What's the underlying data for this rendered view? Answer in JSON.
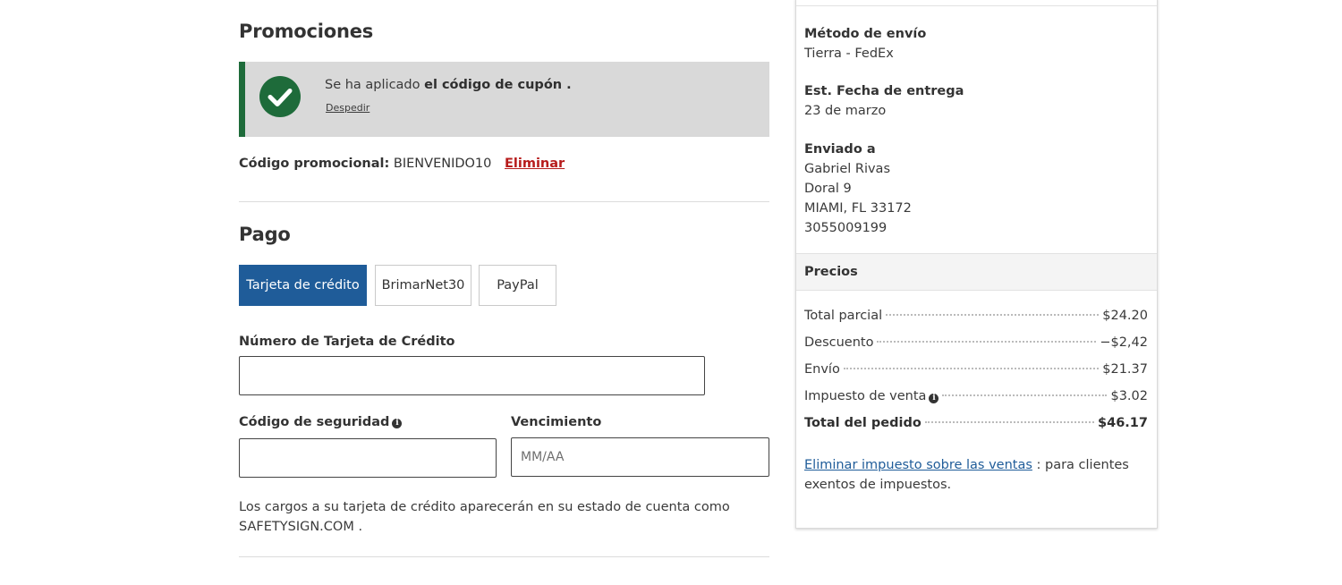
{
  "promotions": {
    "title": "Promociones",
    "banner": {
      "message_prefix": "Se ha aplicado",
      "message_bold": "el código de cupón .",
      "dismiss_label": "Despedir"
    },
    "code_label": "Código promocional:",
    "code_value": "BIENVENIDO10",
    "remove_label": "Eliminar"
  },
  "payment": {
    "title": "Pago",
    "tabs": [
      {
        "label": "Tarjeta de crédito",
        "active": true
      },
      {
        "label": "BrimarNet30",
        "active": false
      },
      {
        "label": "PayPal",
        "active": false
      }
    ],
    "card_number_label": "Número de Tarjeta de Crédito",
    "card_number_value": "",
    "security_code_label": "Código de seguridad",
    "security_code_value": "",
    "expiration_label": "Vencimiento",
    "expiration_placeholder": "MM/AA",
    "disclaimer": "Los cargos a su tarjeta de crédito aparecerán en su estado de cuenta como SAFETYSIGN.COM ."
  },
  "summary": {
    "shipping_method_label": "Método de envío",
    "shipping_method_value": "Tierra - FedEx",
    "delivery_date_label": "Est. Fecha de entrega",
    "delivery_date_value": "23 de marzo",
    "shipped_to_label": "Enviado a",
    "address": {
      "name": "Gabriel Rivas",
      "street": "Doral 9",
      "city_state_zip": "MIAMI, FL 33172",
      "phone": "3055009199"
    },
    "prices_header": "Precios",
    "prices": [
      {
        "label": "Total parcial",
        "value": "$24.20"
      },
      {
        "label": "Descuento",
        "value": "−$2,42"
      },
      {
        "label": "Envío",
        "value": "$21.37"
      },
      {
        "label": "Impuesto de venta",
        "value": "$3.02"
      },
      {
        "label": "Total del pedido",
        "value": "$46.17"
      }
    ],
    "tax_exempt_link": "Eliminar impuesto sobre las ventas",
    "tax_exempt_text": ": para clientes exentos de impuestos."
  },
  "colors": {
    "success_green": "#1e6b3a",
    "primary_blue": "#1f5c99",
    "danger_red": "#b71c1c",
    "banner_bg": "#d9d9d9"
  },
  "icons": {
    "banner_icon": "check-circle-icon",
    "info_icon": "info-circle-icon"
  }
}
